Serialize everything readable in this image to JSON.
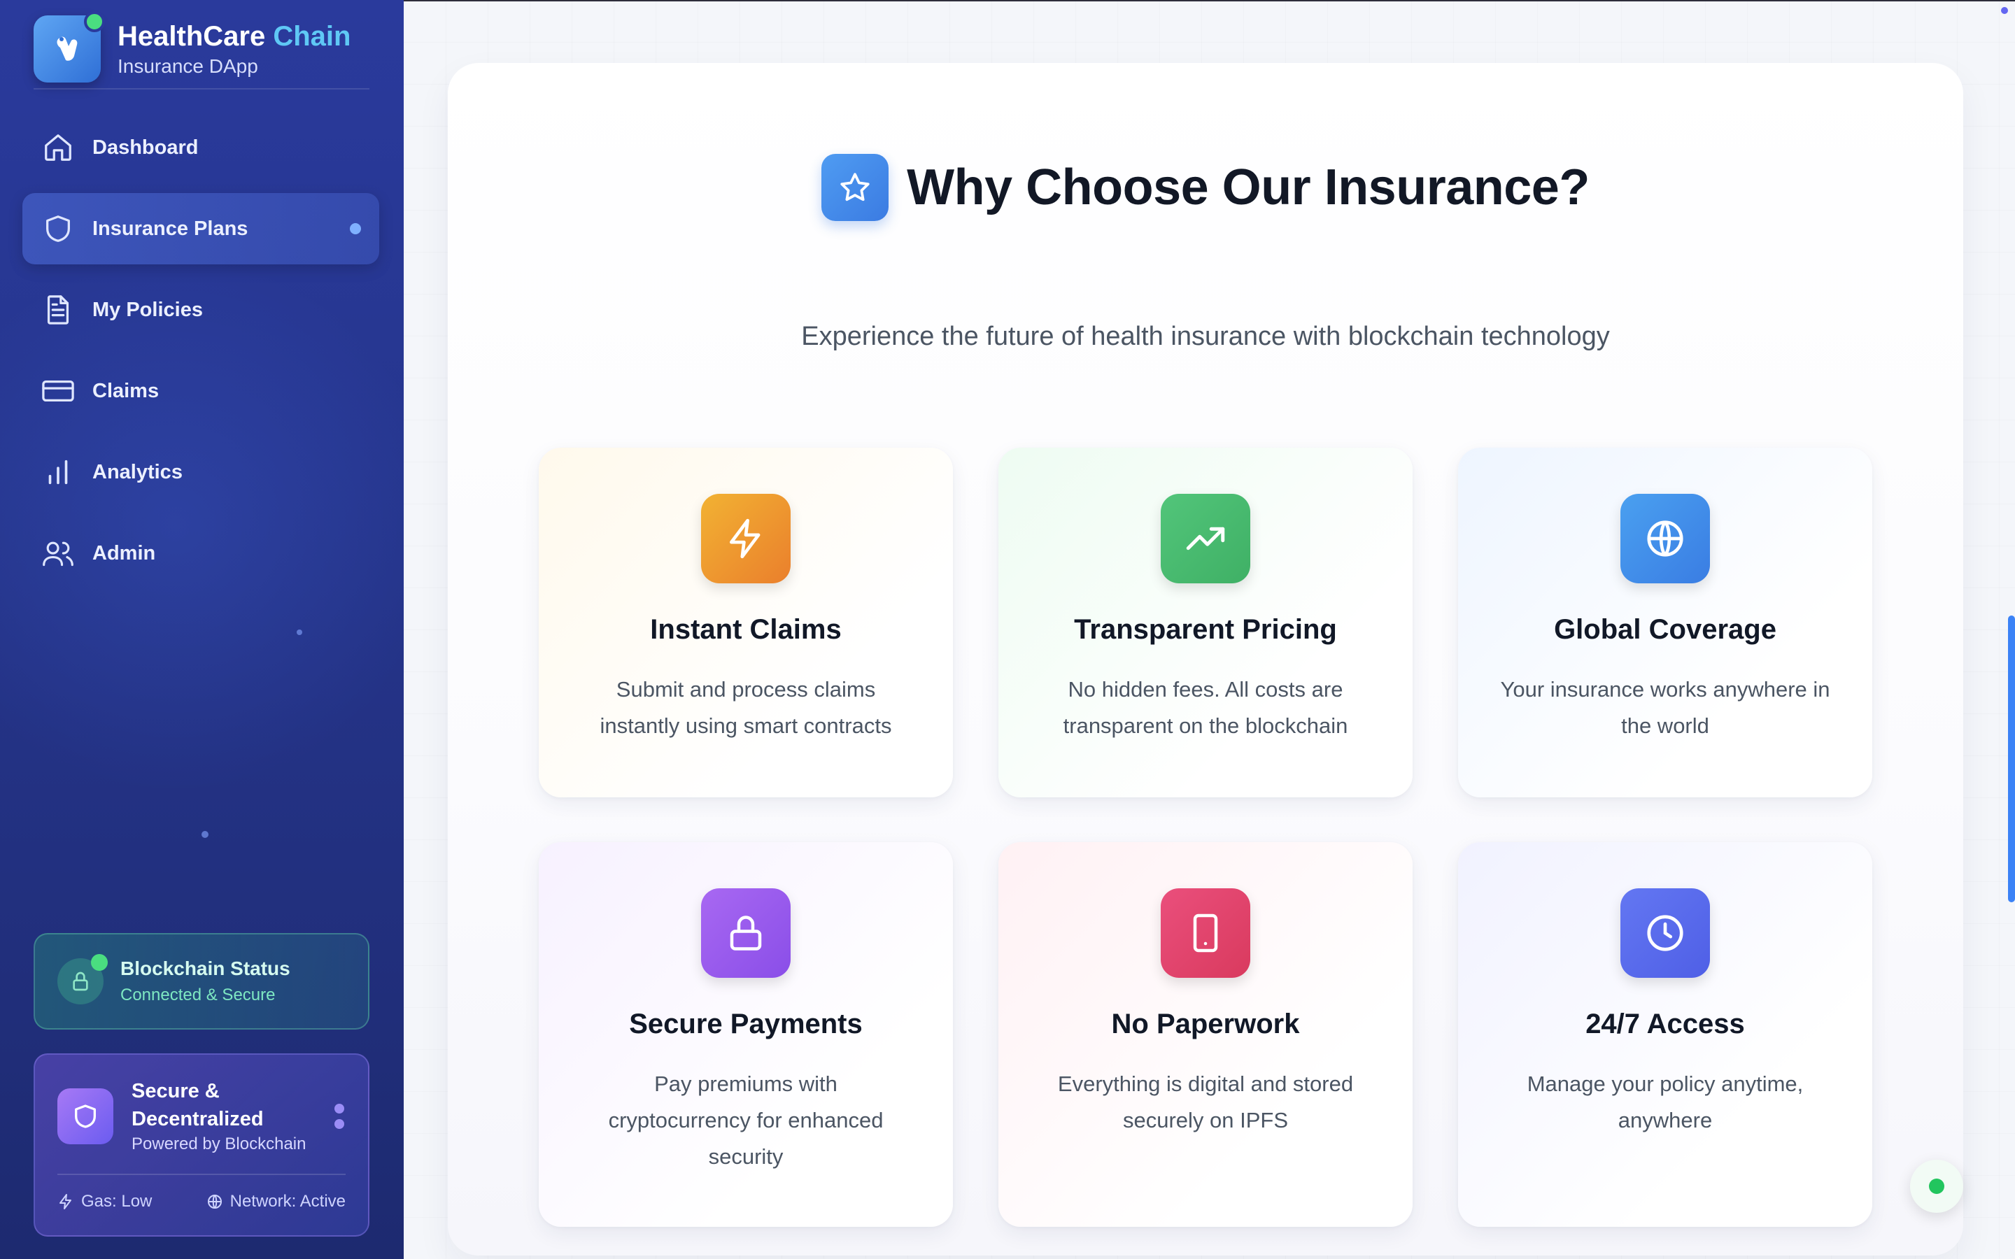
{
  "brand": {
    "title_main": "HealthCare",
    "title_accent": "Chain",
    "subtitle": "Insurance DApp"
  },
  "nav": {
    "items": [
      {
        "label": "Dashboard",
        "icon": "home-icon",
        "active": false
      },
      {
        "label": "Insurance Plans",
        "icon": "shield-icon",
        "active": true
      },
      {
        "label": "My Policies",
        "icon": "document-icon",
        "active": false
      },
      {
        "label": "Claims",
        "icon": "credit-card-icon",
        "active": false
      },
      {
        "label": "Analytics",
        "icon": "bar-chart-icon",
        "active": false
      },
      {
        "label": "Admin",
        "icon": "users-icon",
        "active": false
      }
    ]
  },
  "blockchain_status": {
    "title": "Blockchain Status",
    "subtitle": "Connected & Secure"
  },
  "secure_card": {
    "title": "Secure & Decentralized",
    "subtitle": "Powered by Blockchain",
    "gas": "Gas: Low",
    "network": "Network: Active"
  },
  "main": {
    "title": "Why Choose Our Insurance?",
    "subtitle": "Experience the future of health insurance with blockchain technology",
    "features": [
      {
        "title": "Instant Claims",
        "desc": "Submit and process claims instantly using smart contracts",
        "icon": "lightning-icon",
        "color": "#f0a030"
      },
      {
        "title": "Transparent Pricing",
        "desc": "No hidden fees. All costs are transparent on the blockchain",
        "icon": "trending-up-icon",
        "color": "#4cbf6f"
      },
      {
        "title": "Global Coverage",
        "desc": "Your insurance works anywhere in the world",
        "icon": "globe-icon",
        "color": "#3b8be8"
      },
      {
        "title": "Secure Payments",
        "desc": "Pay premiums with cryptocurrency for enhanced security",
        "icon": "lock-icon",
        "color": "#9b5cf0"
      },
      {
        "title": "No Paperwork",
        "desc": "Everything is digital and stored securely on IPFS",
        "icon": "tablet-icon",
        "color": "#e0476e"
      },
      {
        "title": "24/7 Access",
        "desc": "Manage your policy anytime, anywhere",
        "icon": "clock-icon",
        "color": "#5b6ef0"
      }
    ]
  },
  "colors": {
    "sidebar_bg": "#26368f",
    "accent_blue": "#3b7be2",
    "status_green": "#4ade80"
  }
}
